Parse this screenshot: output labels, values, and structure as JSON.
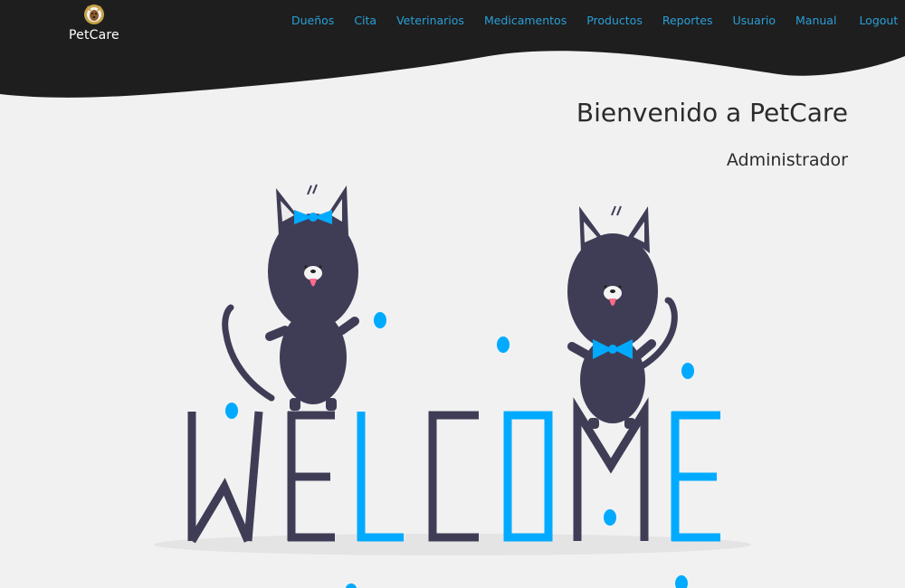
{
  "brand": {
    "name": "PetCare"
  },
  "nav": {
    "items": [
      {
        "label": "Dueños"
      },
      {
        "label": "Cita"
      },
      {
        "label": "Veterinarios"
      },
      {
        "label": "Medicamentos"
      },
      {
        "label": "Productos"
      },
      {
        "label": "Reportes"
      },
      {
        "label": "Usuario"
      },
      {
        "label": "Manual"
      },
      {
        "label": "Logout"
      }
    ]
  },
  "main": {
    "title": "Bienvenido a PetCare",
    "role": "Administrador"
  },
  "illustration": {
    "letters": [
      "W",
      "E",
      "L",
      "C",
      "O",
      "M",
      "E"
    ],
    "icon": "welcome-cats-illustration"
  },
  "colors": {
    "header": "#1e1e1e",
    "nav_link": "#2a9fd6",
    "accent_blue": "#00aaff",
    "cat_dark": "#3f3d56",
    "background": "#f1f1f1"
  }
}
